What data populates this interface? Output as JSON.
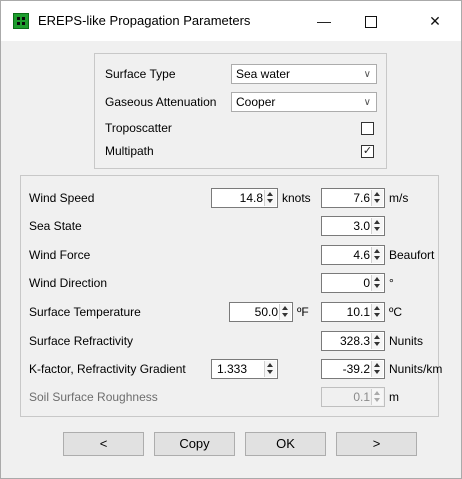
{
  "window": {
    "title": "EREPS-like Propagation Parameters",
    "minimize_glyph": "—",
    "close_glyph": "✕"
  },
  "top_group": {
    "surface_type": {
      "label": "Surface Type",
      "value": "Sea water"
    },
    "gaseous_attenuation": {
      "label": "Gaseous Attenuation",
      "value": "Cooper"
    },
    "troposcatter": {
      "label": "Troposcatter",
      "checked": false,
      "mark": ""
    },
    "multipath": {
      "label": "Multipath",
      "checked": true,
      "mark": "✓"
    },
    "dropdown_glyph": "∨"
  },
  "params": {
    "wind_speed": {
      "label": "Wind Speed",
      "value1": "14.8",
      "unit1": "knots",
      "value2": "7.6",
      "unit2": "m/s"
    },
    "sea_state": {
      "label": "Sea State",
      "value": "3.0"
    },
    "wind_force": {
      "label": "Wind Force",
      "value": "4.6",
      "unit": "Beaufort"
    },
    "wind_direction": {
      "label": "Wind Direction",
      "value": "0",
      "unit": "°"
    },
    "surface_temperature": {
      "label": "Surface Temperature",
      "value1": "50.0",
      "unit1": "ºF",
      "value2": "10.1",
      "unit2": "ºC"
    },
    "surface_refractivity": {
      "label": "Surface Refractivity",
      "value": "328.3",
      "unit": "Nunits"
    },
    "k_factor": {
      "label": "K-factor, Refractivity Gradient",
      "value1": "1.333",
      "value2": "-39.2",
      "unit2": "Nunits/km"
    },
    "soil_roughness": {
      "label": "Soil Surface Roughness",
      "value": "0.1",
      "unit": "m"
    }
  },
  "buttons": {
    "prev": "<",
    "copy": "Copy",
    "ok": "OK",
    "next": ">"
  }
}
